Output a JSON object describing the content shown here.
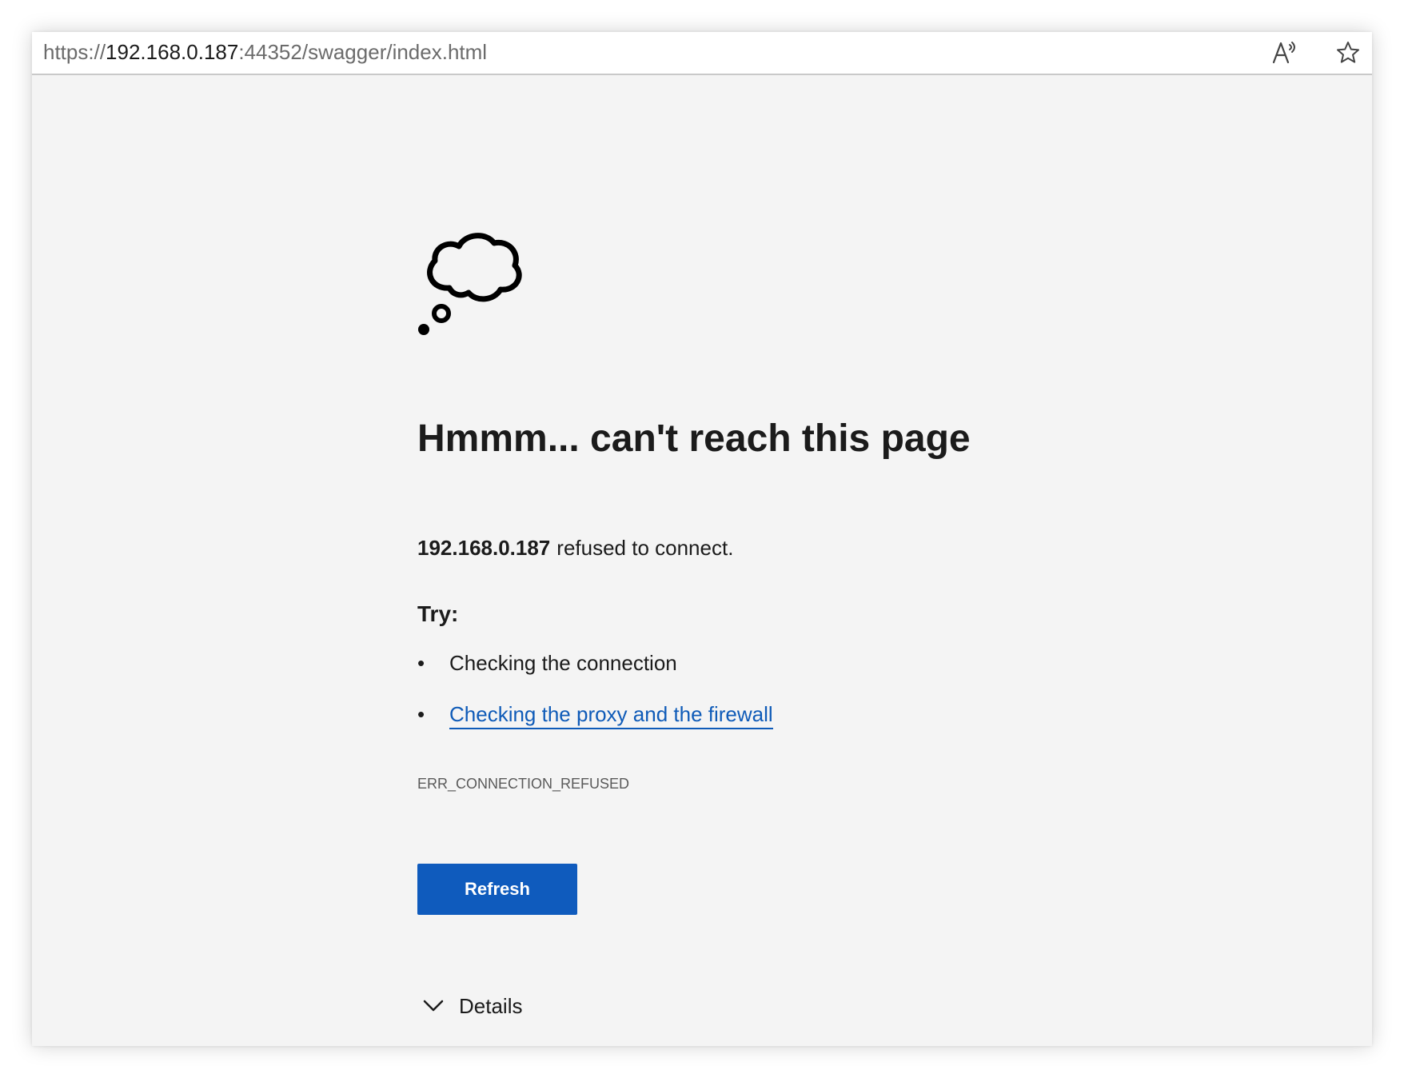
{
  "address_bar": {
    "url_prefix": "https://",
    "url_host": "192.168.0.187",
    "url_rest": ":44352/swagger/index.html",
    "read_aloud_icon": "read-aloud-icon",
    "favorite_icon": "star-icon"
  },
  "error_page": {
    "icon": "thought-cloud-icon",
    "heading": "Hmmm... can't reach this page",
    "host": "192.168.0.187",
    "message": "refused to connect.",
    "try_label": "Try:",
    "bullet": "•",
    "tips": [
      {
        "text": "Checking the connection",
        "is_link": false
      },
      {
        "text": "Checking the proxy and the firewall",
        "is_link": true
      }
    ],
    "error_code": "ERR_CONNECTION_REFUSED",
    "refresh_label": "Refresh",
    "details_label": "Details"
  },
  "colors": {
    "page_background": "#f4f4f4",
    "link": "#0f5bb8",
    "button": "#0f5bbd"
  }
}
